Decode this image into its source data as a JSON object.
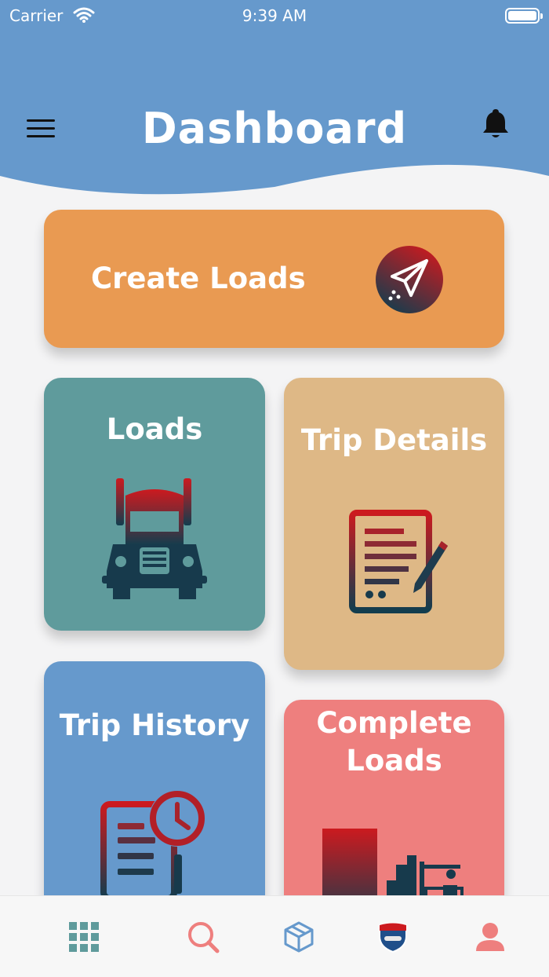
{
  "status_bar": {
    "carrier": "Carrier",
    "time": "9:39 AM"
  },
  "header": {
    "title": "Dashboard",
    "menu_icon": "hamburger-menu-icon",
    "notification_icon": "bell-icon"
  },
  "cards": {
    "create_loads": {
      "label": "Create Loads",
      "icon": "paper-plane-icon",
      "color": "#e99a52"
    },
    "loads": {
      "label": "Loads",
      "icon": "truck-icon",
      "color": "#5f9b9c"
    },
    "trip_details": {
      "label": "Trip Details",
      "icon": "document-edit-icon",
      "color": "#deb886"
    },
    "trip_history": {
      "label": "Trip History",
      "icon": "history-clock-icon",
      "color": "#6699cc"
    },
    "complete_loads": {
      "label": "Complete\nLoads",
      "icon": "warehouse-forklift-icon",
      "color": "#ee7f7e"
    }
  },
  "tab_bar": {
    "items": [
      {
        "icon": "grid-icon",
        "color": "#5f9b9c"
      },
      {
        "icon": "search-icon",
        "color": "#ee7f7e"
      },
      {
        "icon": "package-icon",
        "color": "#6699cc"
      },
      {
        "icon": "highway-shield-icon",
        "color": "#1f4f8a"
      },
      {
        "icon": "profile-icon",
        "color": "#ee7f7e"
      }
    ]
  },
  "colors": {
    "header_bg": "#6699cc",
    "page_bg": "#f4f4f5",
    "icon_gradient_top": "#cc1a1f",
    "icon_gradient_bottom": "#123d4e"
  }
}
